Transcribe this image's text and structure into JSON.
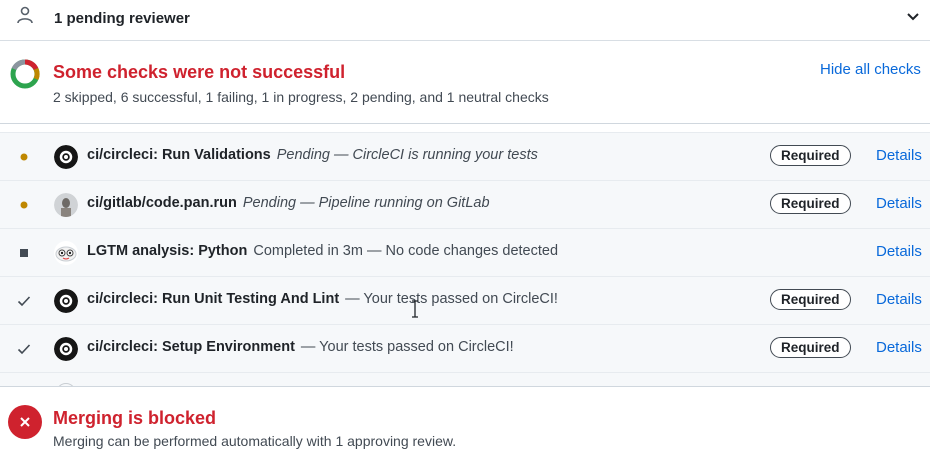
{
  "reviewers": {
    "text": "1 pending reviewer",
    "icon": "person-icon",
    "toggle_icon": "chevron-down-icon"
  },
  "checks": {
    "title": "Some checks were not successful",
    "summary": "2 skipped, 6 successful, 1 failing, 1 in progress, 2 pending, and 1 neutral checks",
    "hide_label": "Hide all checks",
    "rows": [
      {
        "status": "pending",
        "avatar": "circleci",
        "name": "ci/circleci: Run Validations",
        "desc": "Pending — CircleCI is running your tests",
        "italic": true,
        "required": "Required",
        "details": "Details"
      },
      {
        "status": "pending",
        "avatar": "gitlab",
        "name": "ci/gitlab/code.pan.run",
        "desc": "Pending — Pipeline running on GitLab",
        "italic": true,
        "required": "Required",
        "details": "Details"
      },
      {
        "status": "neutral",
        "avatar": "lgtm",
        "name": "LGTM analysis: Python",
        "desc": "Completed in 3m — No code changes detected",
        "italic": false,
        "required": "",
        "details": "Details"
      },
      {
        "status": "success",
        "avatar": "circleci",
        "name": "ci/circleci: Run Unit Testing And Lint",
        "desc": "— Your tests passed on CircleCI!",
        "italic": false,
        "required": "Required",
        "details": "Details"
      },
      {
        "status": "success",
        "avatar": "circleci",
        "name": "ci/circleci: Setup Environment",
        "desc": "— Your tests passed on CircleCI!",
        "italic": false,
        "required": "Required",
        "details": "Details"
      }
    ]
  },
  "merge": {
    "title": "Merging is blocked",
    "desc": "Merging can be performed automatically with 1 approving review.",
    "icon": "x-circle-icon"
  },
  "colors": {
    "danger": "#cf222e",
    "link": "#0969da",
    "pending": "#bf8700",
    "success": "#1a7f37"
  }
}
